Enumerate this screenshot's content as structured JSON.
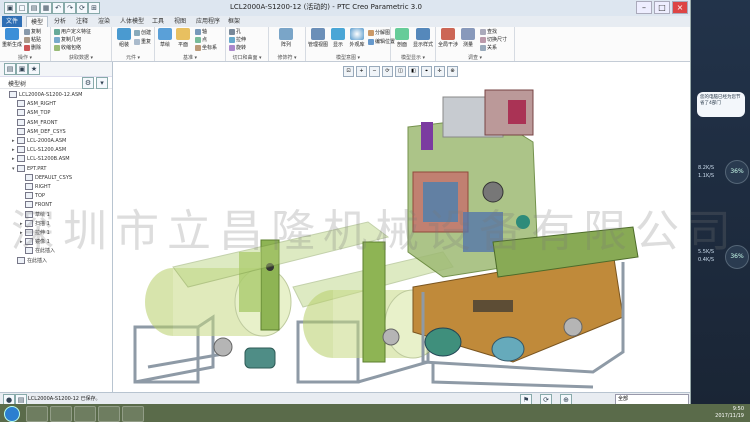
{
  "window": {
    "title": "LCL2000A-S1200-12 (活动的) - PTC Creo Parametric 3.0"
  },
  "tabs": [
    "文件",
    "模型",
    "分析",
    "注释",
    "渲染",
    "人体模型",
    "工具",
    "视图",
    "应用程序",
    "框架"
  ],
  "ribbon": {
    "groups": [
      {
        "label": "操作 ▾",
        "items": [
          "重新生成"
        ],
        "small": [
          "复制",
          "粘贴",
          "删除"
        ]
      },
      {
        "label": "获取数据 ▾",
        "items": [],
        "small": [
          "用户定义特征",
          "复制几何",
          "收缩包络"
        ]
      },
      {
        "label": "元件 ▾",
        "items": [
          "组装"
        ],
        "small": [
          "创建",
          "重复"
        ]
      },
      {
        "label": "基准 ▾",
        "items": [
          "草绘",
          "平面"
        ],
        "small": [
          "轴",
          "点",
          "坐标系"
        ]
      },
      {
        "label": "切口和曲面 ▾",
        "items": [],
        "small": [
          "孔",
          "拉伸",
          "旋转"
        ]
      },
      {
        "label": "修饰符 ▾",
        "items": [
          "阵列"
        ],
        "small": []
      },
      {
        "label": "模型意图 ▾",
        "items": [
          "管理视图",
          "显示",
          "外观库"
        ],
        "small": [
          "分解图",
          "编辑位置"
        ]
      },
      {
        "label": "模型显示 ▾",
        "items": [
          "剖面",
          "显示样式"
        ],
        "small": []
      },
      {
        "label": "调查 ▾",
        "items": [
          "全局干涉",
          "测量"
        ],
        "small": [
          "查找",
          "切换尺寸",
          "关系"
        ]
      }
    ]
  },
  "model_tree": {
    "header": "模型树",
    "items": [
      {
        "label": "LCL2000A-S1200-12.ASM",
        "indent": 0,
        "expand": ""
      },
      {
        "label": "ASM_RIGHT",
        "indent": 1,
        "expand": ""
      },
      {
        "label": "ASM_TOP",
        "indent": 1,
        "expand": ""
      },
      {
        "label": "ASM_FRONT",
        "indent": 1,
        "expand": ""
      },
      {
        "label": "ASM_DEF_CSYS",
        "indent": 1,
        "expand": ""
      },
      {
        "label": "LCL-2000A.ASM",
        "indent": 1,
        "expand": "▸"
      },
      {
        "label": "LCL-S1200.ASM",
        "indent": 1,
        "expand": "▸"
      },
      {
        "label": "LCL-S1200B.ASM",
        "indent": 1,
        "expand": "▸"
      },
      {
        "label": "EPT.PRT",
        "indent": 1,
        "expand": "▾"
      },
      {
        "label": "DEFAULT_CSYS",
        "indent": 2,
        "expand": ""
      },
      {
        "label": "RIGHT",
        "indent": 2,
        "expand": ""
      },
      {
        "label": "TOP",
        "indent": 2,
        "expand": ""
      },
      {
        "label": "FRONT",
        "indent": 2,
        "expand": ""
      },
      {
        "label": "草绘 1",
        "indent": 2,
        "expand": ""
      },
      {
        "label": "扫描 1",
        "indent": 2,
        "expand": "▸"
      },
      {
        "label": "拉伸 1",
        "indent": 2,
        "expand": "▸"
      },
      {
        "label": "镜像 1",
        "indent": 2,
        "expand": "▸"
      },
      {
        "label": "在此插入",
        "indent": 2,
        "expand": ""
      },
      {
        "label": "在此插入",
        "indent": 1,
        "expand": ""
      }
    ]
  },
  "status": {
    "message": "LCL2000A-S1200-12 已保存。",
    "filter": "全部"
  },
  "taskbar": {
    "time": "9:50",
    "date": "2017/11/19"
  },
  "watermark": "深圳市立昌隆机械设备有限公司",
  "desktop": {
    "bubble_text": "您的电脑已经为您节省了4部门",
    "widget1": "36%",
    "widget2": "36%",
    "speed1": "8.2K/S",
    "speed2": "1.1K/S",
    "speed3": "5.5K/S",
    "speed4": "0.4K/S"
  },
  "colors": {
    "accent": "#2f6fb5",
    "frame": "#9aa6b2",
    "green_part": "#7fae3e",
    "bronze_part": "#c08a3a"
  }
}
